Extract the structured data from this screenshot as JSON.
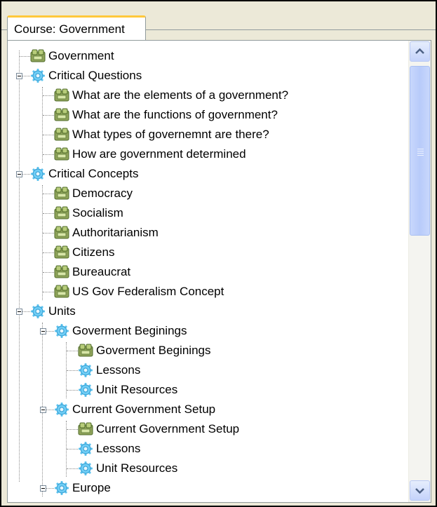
{
  "tab": {
    "label": "Course: Government"
  },
  "tree": [
    {
      "id": "government",
      "label": "Government",
      "icon": "topic-icon",
      "level": 0
    },
    {
      "id": "critical-questions",
      "label": "Critical Questions",
      "icon": "folder-gear-icon",
      "level": 0,
      "expanded": true
    },
    {
      "id": "q-elements",
      "label": "What are the elements of a government?",
      "icon": "topic-icon",
      "level": 1
    },
    {
      "id": "q-functions",
      "label": "What are the functions of government?",
      "icon": "topic-icon",
      "level": 1
    },
    {
      "id": "q-types",
      "label": "What types of governemnt are there?",
      "icon": "topic-icon",
      "level": 1
    },
    {
      "id": "q-determined",
      "label": "How are government determined",
      "icon": "topic-icon",
      "level": 1
    },
    {
      "id": "critical-concepts",
      "label": "Critical Concepts",
      "icon": "folder-gear-icon",
      "level": 0,
      "expanded": true
    },
    {
      "id": "democracy",
      "label": "Democracy",
      "icon": "topic-icon",
      "level": 1
    },
    {
      "id": "socialism",
      "label": "Socialism",
      "icon": "topic-icon",
      "level": 1
    },
    {
      "id": "authoritarianism",
      "label": "Authoritarianism",
      "icon": "topic-icon",
      "level": 1
    },
    {
      "id": "citizens",
      "label": "Citizens",
      "icon": "topic-icon",
      "level": 1
    },
    {
      "id": "bureaucrat",
      "label": "Bureaucrat",
      "icon": "topic-icon",
      "level": 1
    },
    {
      "id": "us-gov-federalism",
      "label": "US Gov Federalism Concept",
      "icon": "topic-icon",
      "level": 1
    },
    {
      "id": "units",
      "label": "Units",
      "icon": "folder-gear-icon",
      "level": 0,
      "expanded": true
    },
    {
      "id": "gov-beginings",
      "label": "Goverment Beginings",
      "icon": "folder-gear-icon",
      "level": 1,
      "expanded": true
    },
    {
      "id": "gov-beginings-topic",
      "label": "Goverment Beginings",
      "icon": "topic-icon",
      "level": 2
    },
    {
      "id": "gov-beginings-lessons",
      "label": "Lessons",
      "icon": "folder-gear-icon",
      "level": 2
    },
    {
      "id": "gov-beginings-resources",
      "label": "Unit Resources",
      "icon": "folder-gear-icon",
      "level": 2
    },
    {
      "id": "current-gov-setup",
      "label": "Current Government Setup",
      "icon": "folder-gear-icon",
      "level": 1,
      "expanded": true
    },
    {
      "id": "current-gov-setup-topic",
      "label": "Current Government Setup",
      "icon": "topic-icon",
      "level": 2
    },
    {
      "id": "current-gov-lessons",
      "label": "Lessons",
      "icon": "folder-gear-icon",
      "level": 2
    },
    {
      "id": "current-gov-resources",
      "label": "Unit Resources",
      "icon": "folder-gear-icon",
      "level": 2
    },
    {
      "id": "europe",
      "label": "Europe",
      "icon": "folder-gear-icon",
      "level": 1,
      "expanded": true
    }
  ],
  "scrollbar": {
    "up_icon": "chevron-up-icon",
    "down_icon": "chevron-down-icon",
    "position": 0
  }
}
